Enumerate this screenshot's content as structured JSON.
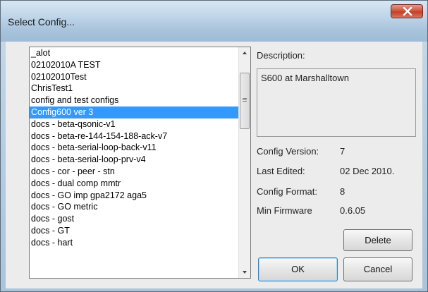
{
  "window": {
    "title": "Select Config..."
  },
  "list": {
    "items": [
      "_alot",
      "02102010A TEST",
      "02102010Test",
      "ChrisTest1",
      "config and test configs",
      "Config600 ver 3",
      "docs - beta-qsonic-v1",
      "docs - beta-re-144-154-188-ack-v7",
      "docs - beta-serial-loop-back-v11",
      "docs - beta-serial-loop-prv-v4",
      "docs - cor - peer - stn",
      "docs - dual comp mmtr",
      "docs - GO imp gpa2172 aga5",
      "docs - GO metric",
      "docs - gost",
      "docs - GT",
      "docs - hart"
    ],
    "selected_index": 5
  },
  "details": {
    "description_label": "Description:",
    "description_value": "S600 at Marshalltown",
    "config_version_label": "Config Version:",
    "config_version_value": "7",
    "last_edited_label": "Last Edited:",
    "last_edited_value": "02 Dec 2010.",
    "config_format_label": "Config Format:",
    "config_format_value": "8",
    "min_firmware_label": "Min Firmware",
    "min_firmware_value": "0.6.05"
  },
  "buttons": {
    "delete": "Delete",
    "ok": "OK",
    "cancel": "Cancel"
  }
}
